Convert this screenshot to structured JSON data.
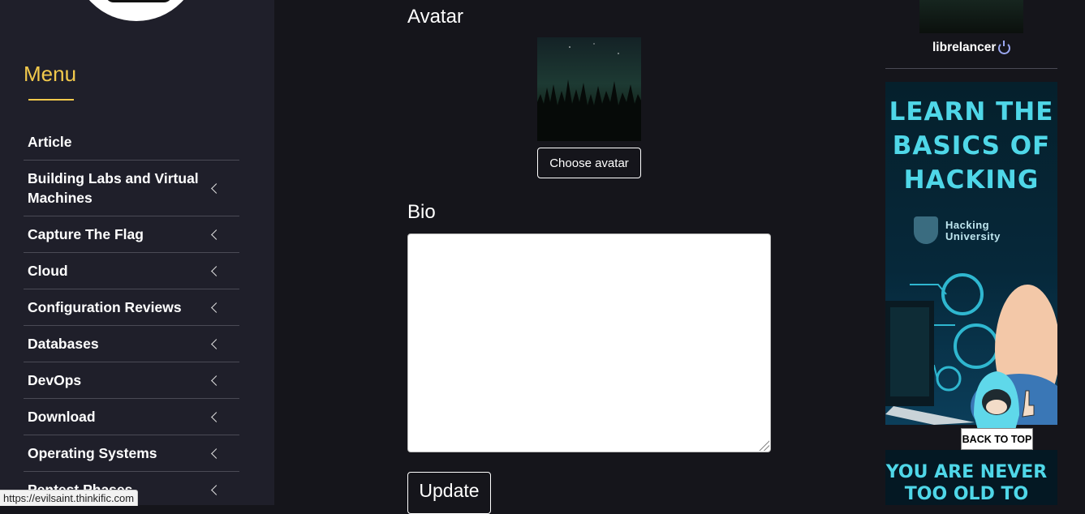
{
  "sidebar": {
    "menu_title": "Menu",
    "items": [
      {
        "label": "Article",
        "has_children": false
      },
      {
        "label": "Building Labs and Virtual Machines",
        "has_children": true
      },
      {
        "label": "Capture The Flag",
        "has_children": true
      },
      {
        "label": "Cloud",
        "has_children": true
      },
      {
        "label": "Configuration Reviews",
        "has_children": true
      },
      {
        "label": "Databases",
        "has_children": true
      },
      {
        "label": "DevOps",
        "has_children": true
      },
      {
        "label": "Download",
        "has_children": true
      },
      {
        "label": "Operating Systems",
        "has_children": true
      },
      {
        "label": "Pentest Phases",
        "has_children": true
      }
    ]
  },
  "main": {
    "avatar_label": "Avatar",
    "choose_avatar_label": "Choose avatar",
    "bio_label": "Bio",
    "bio_value": "",
    "update_label": "Update"
  },
  "right": {
    "username": "librelancer",
    "ad1": {
      "title": "LEARN THE BASICS OF HACKING",
      "brand_line1": "Hacking",
      "brand_line2": "University"
    },
    "ad2_text": "YOU ARE NEVER TOO OLD TO",
    "back_to_top_label": "BACK TO TOP"
  },
  "status_bar": {
    "url": "https://evilsaint.thinkific.com"
  },
  "colors": {
    "accent": "#f2c94c",
    "background": "#15151b",
    "sidebar": "#1f1f2a",
    "ad_cyan": "#4fd7e8"
  }
}
